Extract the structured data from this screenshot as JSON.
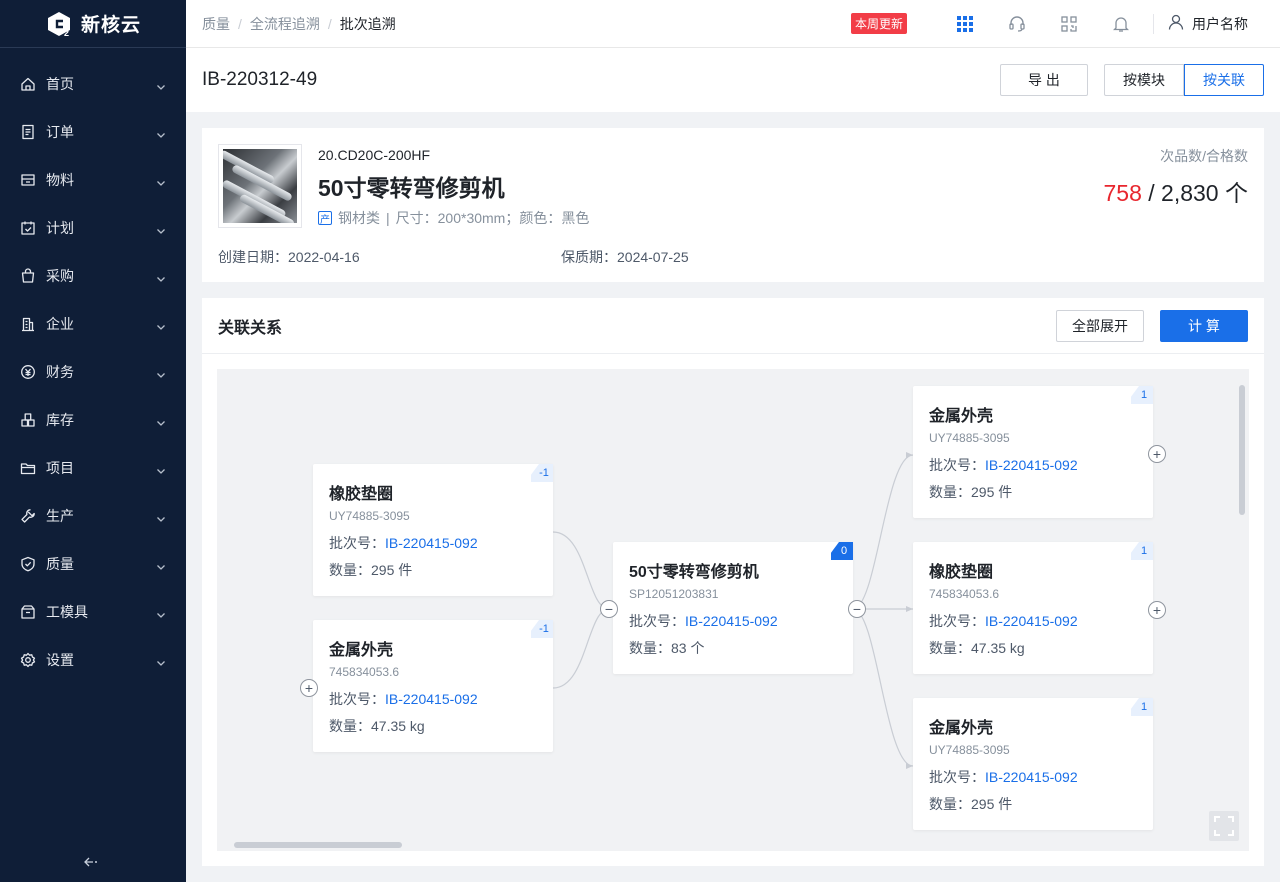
{
  "brand": {
    "name": "新核云"
  },
  "sidebar": {
    "items": [
      {
        "label": "首页",
        "icon": "home-icon"
      },
      {
        "label": "订单",
        "icon": "order-icon"
      },
      {
        "label": "物料",
        "icon": "material-icon"
      },
      {
        "label": "计划",
        "icon": "plan-icon"
      },
      {
        "label": "采购",
        "icon": "purchase-icon"
      },
      {
        "label": "企业",
        "icon": "enterprise-icon"
      },
      {
        "label": "财务",
        "icon": "finance-icon"
      },
      {
        "label": "库存",
        "icon": "inventory-icon"
      },
      {
        "label": "项目",
        "icon": "project-icon"
      },
      {
        "label": "生产",
        "icon": "production-icon"
      },
      {
        "label": "质量",
        "icon": "quality-icon"
      },
      {
        "label": "工模具",
        "icon": "tooling-icon"
      },
      {
        "label": "设置",
        "icon": "settings-icon"
      }
    ],
    "collapse_label": "←·"
  },
  "header": {
    "breadcrumb": [
      "质量",
      "全流程追溯",
      "批次追溯"
    ],
    "badge": "本周更新",
    "user_name": "用户名称"
  },
  "page": {
    "batch_id": "IB-220312-49",
    "export_label": "导 出",
    "by_module_label": "按模块",
    "by_relation_label": "按关联"
  },
  "product": {
    "code": "20.CD20C-200HF",
    "name": "50寸零转弯修剪机",
    "category": "钢材类",
    "tag_char": "产",
    "spec": "尺寸：200*30mm；颜色：黑色",
    "created": "创建日期：2022-04-16",
    "expiry": "保质期：2024-07-25",
    "ratio_label": "次品数/合格数",
    "defects": "758",
    "ratio_sep": " / ",
    "qualified": "2,830 个"
  },
  "relation": {
    "title": "关联关系",
    "expand_all_label": "全部展开",
    "compute_label": "计 算",
    "batch_prefix": "批次号：",
    "qty_prefix": "数量：",
    "nodes": [
      {
        "name": "橡胶垫圈",
        "code": "UY74885-3095",
        "batch": "IB-220415-092",
        "qty": "295 件",
        "level": "-1"
      },
      {
        "name": "金属外壳",
        "code": "745834053.6",
        "batch": "IB-220415-092",
        "qty": "47.35 kg",
        "level": "-1"
      },
      {
        "name": "50寸零转弯修剪机",
        "code": "SP12051203831",
        "batch": "IB-220415-092",
        "qty": "83 个",
        "level": "0"
      },
      {
        "name": "金属外壳",
        "code": "UY74885-3095",
        "batch": "IB-220415-092",
        "qty": "295 件",
        "level": "1"
      },
      {
        "name": "橡胶垫圈",
        "code": "745834053.6",
        "batch": "IB-220415-092",
        "qty": "47.35 kg",
        "level": "1"
      },
      {
        "name": "金属外壳",
        "code": "UY74885-3095",
        "batch": "IB-220415-092",
        "qty": "295 件",
        "level": "1"
      }
    ]
  },
  "colors": {
    "primary": "#1a6fe8",
    "danger": "#e8262e",
    "sidebar_bg": "#0f1e37",
    "badge": "#f23d47"
  }
}
